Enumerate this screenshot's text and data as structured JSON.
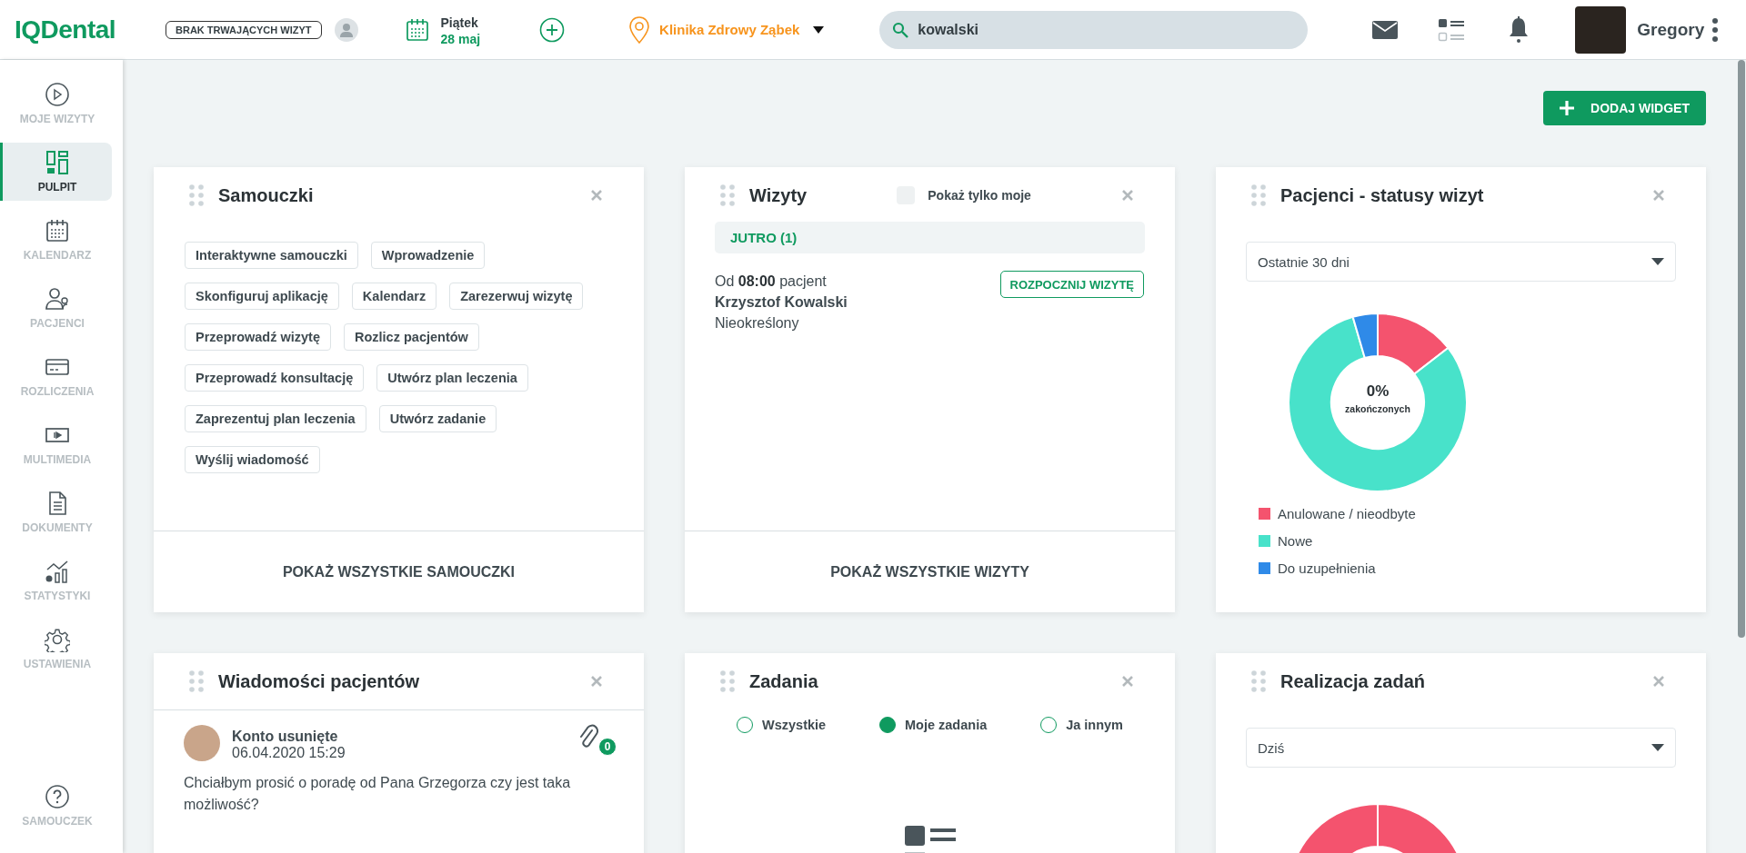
{
  "header": {
    "logo": "IQDental",
    "visit_status": "BRAK TRWAJĄCYCH WIZYT",
    "day": "Piątek",
    "date": "28 maj",
    "clinic": "Klinika Zdrowy Ząbek",
    "search": {
      "value": "kowalski"
    },
    "user": "Gregory"
  },
  "sidebar": {
    "items": [
      {
        "label": "MOJE WIZYTY",
        "kind": "play",
        "selected": false
      },
      {
        "label": "PULPIT",
        "kind": "dashboard",
        "selected": true
      },
      {
        "label": "KALENDARZ",
        "kind": "calendar",
        "selected": false
      },
      {
        "label": "PACJENCI",
        "kind": "patients",
        "selected": false
      },
      {
        "label": "ROZLICZENIA",
        "kind": "card",
        "selected": false
      },
      {
        "label": "MULTIMEDIA",
        "kind": "media",
        "selected": false
      },
      {
        "label": "DOKUMENTY",
        "kind": "document",
        "selected": false
      },
      {
        "label": "STATYSTYKI",
        "kind": "stats",
        "selected": false
      },
      {
        "label": "USTAWIENIA",
        "kind": "settings",
        "selected": false
      }
    ],
    "help": {
      "label": "SAMOUCZEK"
    }
  },
  "toolbar": {
    "add_widget": "DODAJ WIDGET"
  },
  "widgets": [
    {
      "kind": "tutorials",
      "title": "Samouczki",
      "tags": [
        "Interaktywne samouczki",
        "Wprowadzenie",
        "Skonfiguruj aplikację",
        "Kalendarz",
        "Zarezerwuj wizytę",
        "Przeprowadź wizytę",
        "Rozlicz pacjentów",
        "Przeprowadź konsultację",
        "Utwórz plan leczenia",
        "Zaprezentuj plan leczenia",
        "Utwórz zadanie",
        "Wyślij wiadomość"
      ],
      "footer": "POKAŻ WSZYSTKIE SAMOUCZKI"
    },
    {
      "kind": "visits",
      "title": "Wizyty",
      "filter": {
        "label": "Pokaż tylko moje",
        "checked": false
      },
      "group": "JUTRO (1)",
      "visits": [
        {
          "text": "Od **08:00** pacjent",
          "patient": "Krzysztof Kowalski",
          "type": "Nieokreślony",
          "action": "ROZPOCZNIJ WIZYTĘ"
        }
      ],
      "footer": "POKAŻ WSZYSTKIE WIZYTY"
    },
    {
      "kind": "status_chart",
      "title": "Pacjenci - statusy wizyt",
      "period": "Ostatnie 30 dni",
      "center_value": "0%",
      "center_label": "zakończonych",
      "legend": [
        {
          "label": "Anulowane / nieodbyte",
          "color": "#f4536e"
        },
        {
          "label": "Nowe",
          "color": "#48e2ca"
        },
        {
          "label": "Do uzupełnienia",
          "color": "#2f8ae8"
        }
      ]
    },
    {
      "kind": "messages",
      "title": "Wiadomości pacjentów",
      "messages": [
        {
          "sender": "Konto usunięte",
          "time": "06.04.2020 15:29",
          "attachments": "0",
          "text": "Chciałbym prosić o poradę od Pana Grzegorza czy jest taka możliwość?"
        }
      ]
    },
    {
      "kind": "tasks",
      "title": "Zadania",
      "filters": [
        {
          "label": "Wszystkie",
          "selected": false
        },
        {
          "label": "Moje zadania",
          "selected": true
        },
        {
          "label": "Ja innym",
          "selected": false
        }
      ]
    },
    {
      "kind": "task_chart",
      "title": "Realizacja zadań",
      "period": "Dziś"
    }
  ]
}
